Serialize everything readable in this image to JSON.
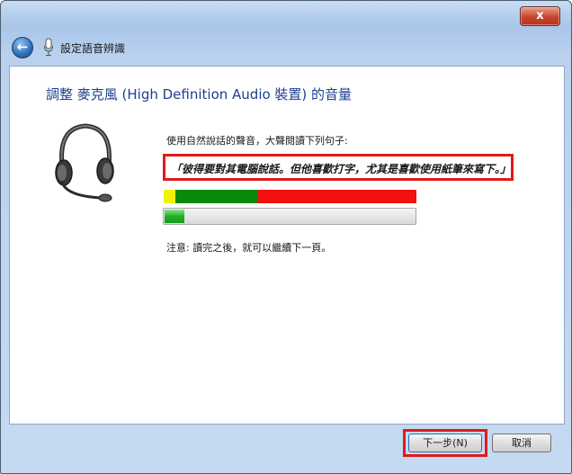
{
  "window": {
    "title": "設定語音辨識",
    "close_label": "x"
  },
  "nav": {
    "back_symbol": "←"
  },
  "page": {
    "heading": "調整 麥克風 (High Definition Audio 裝置) 的音量",
    "instruction": "使用自然說話的聲音，大聲閱讀下列句子:",
    "sample_sentence": "「彼得要對其電腦說話。但他喜歡打字，尤其是喜歡使用紙筆來寫下。」",
    "note": "注意: 讀完之後，就可以繼續下一頁。"
  },
  "level_meter": {
    "colors": {
      "low": "#f2f200",
      "good": "#0a8a0a",
      "high": "#f21010"
    }
  },
  "volume_progress": {
    "fraction": 0.08
  },
  "footer": {
    "next_label": "下一步(N)",
    "cancel_label": "取消"
  },
  "highlight_color": "#e21a1a"
}
